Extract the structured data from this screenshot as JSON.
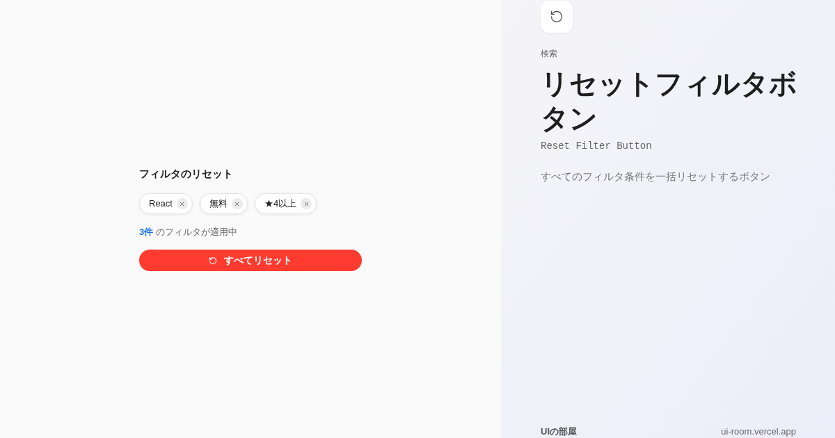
{
  "demo": {
    "title": "フィルタのリセット",
    "filters": [
      {
        "label": "React"
      },
      {
        "label": "無料"
      },
      {
        "label": "★4以上"
      }
    ],
    "count": "3件",
    "count_text": "のフィルタが適用中",
    "reset_button": "すべてリセット"
  },
  "info": {
    "category": "検索",
    "title": "リセットフィルタボタン",
    "subtitle": "Reset Filter Button",
    "description": "すべてのフィルタ条件を一括リセットするボタン"
  },
  "footer": {
    "brand": "UIの部屋",
    "url": "ui-room.vercel.app"
  }
}
